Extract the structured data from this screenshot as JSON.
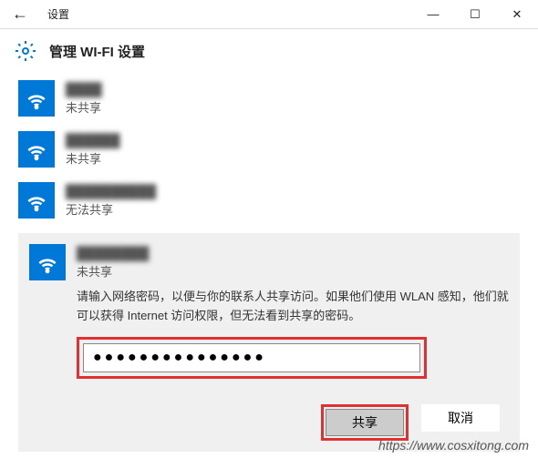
{
  "window": {
    "title": "设置",
    "back_glyph": "←",
    "min_glyph": "—",
    "max_glyph": "☐",
    "close_glyph": "✕"
  },
  "header": {
    "title": "管理 WI-FI 设置"
  },
  "networks": [
    {
      "name": "████",
      "status": "未共享"
    },
    {
      "name": "██████",
      "status": "未共享"
    },
    {
      "name": "██████████",
      "status": "无法共享"
    }
  ],
  "expanded": {
    "name": "████████",
    "status": "未共享",
    "description": "请输入网络密码，以便与你的联系人共享访问。如果他们使用 WLAN 感知，他们就可以获得 Internet 访问权限，但无法看到共享的密码。",
    "password_value": "●●●●●●●●●●●●●●●",
    "share_label": "共享",
    "cancel_label": "取消"
  },
  "watermark": "https://www.cosxitong.com"
}
